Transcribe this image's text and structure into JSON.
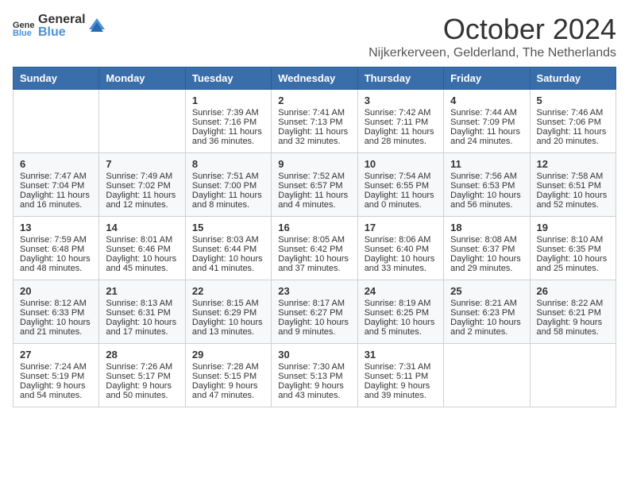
{
  "header": {
    "logo_general": "General",
    "logo_blue": "Blue",
    "month_title": "October 2024",
    "location": "Nijkerkerveen, Gelderland, The Netherlands"
  },
  "days_of_week": [
    "Sunday",
    "Monday",
    "Tuesday",
    "Wednesday",
    "Thursday",
    "Friday",
    "Saturday"
  ],
  "weeks": [
    [
      {
        "day": "",
        "content": ""
      },
      {
        "day": "",
        "content": ""
      },
      {
        "day": "1",
        "content": "Sunrise: 7:39 AM\nSunset: 7:16 PM\nDaylight: 11 hours\nand 36 minutes."
      },
      {
        "day": "2",
        "content": "Sunrise: 7:41 AM\nSunset: 7:13 PM\nDaylight: 11 hours\nand 32 minutes."
      },
      {
        "day": "3",
        "content": "Sunrise: 7:42 AM\nSunset: 7:11 PM\nDaylight: 11 hours\nand 28 minutes."
      },
      {
        "day": "4",
        "content": "Sunrise: 7:44 AM\nSunset: 7:09 PM\nDaylight: 11 hours\nand 24 minutes."
      },
      {
        "day": "5",
        "content": "Sunrise: 7:46 AM\nSunset: 7:06 PM\nDaylight: 11 hours\nand 20 minutes."
      }
    ],
    [
      {
        "day": "6",
        "content": "Sunrise: 7:47 AM\nSunset: 7:04 PM\nDaylight: 11 hours\nand 16 minutes."
      },
      {
        "day": "7",
        "content": "Sunrise: 7:49 AM\nSunset: 7:02 PM\nDaylight: 11 hours\nand 12 minutes."
      },
      {
        "day": "8",
        "content": "Sunrise: 7:51 AM\nSunset: 7:00 PM\nDaylight: 11 hours\nand 8 minutes."
      },
      {
        "day": "9",
        "content": "Sunrise: 7:52 AM\nSunset: 6:57 PM\nDaylight: 11 hours\nand 4 minutes."
      },
      {
        "day": "10",
        "content": "Sunrise: 7:54 AM\nSunset: 6:55 PM\nDaylight: 11 hours\nand 0 minutes."
      },
      {
        "day": "11",
        "content": "Sunrise: 7:56 AM\nSunset: 6:53 PM\nDaylight: 10 hours\nand 56 minutes."
      },
      {
        "day": "12",
        "content": "Sunrise: 7:58 AM\nSunset: 6:51 PM\nDaylight: 10 hours\nand 52 minutes."
      }
    ],
    [
      {
        "day": "13",
        "content": "Sunrise: 7:59 AM\nSunset: 6:48 PM\nDaylight: 10 hours\nand 48 minutes."
      },
      {
        "day": "14",
        "content": "Sunrise: 8:01 AM\nSunset: 6:46 PM\nDaylight: 10 hours\nand 45 minutes."
      },
      {
        "day": "15",
        "content": "Sunrise: 8:03 AM\nSunset: 6:44 PM\nDaylight: 10 hours\nand 41 minutes."
      },
      {
        "day": "16",
        "content": "Sunrise: 8:05 AM\nSunset: 6:42 PM\nDaylight: 10 hours\nand 37 minutes."
      },
      {
        "day": "17",
        "content": "Sunrise: 8:06 AM\nSunset: 6:40 PM\nDaylight: 10 hours\nand 33 minutes."
      },
      {
        "day": "18",
        "content": "Sunrise: 8:08 AM\nSunset: 6:37 PM\nDaylight: 10 hours\nand 29 minutes."
      },
      {
        "day": "19",
        "content": "Sunrise: 8:10 AM\nSunset: 6:35 PM\nDaylight: 10 hours\nand 25 minutes."
      }
    ],
    [
      {
        "day": "20",
        "content": "Sunrise: 8:12 AM\nSunset: 6:33 PM\nDaylight: 10 hours\nand 21 minutes."
      },
      {
        "day": "21",
        "content": "Sunrise: 8:13 AM\nSunset: 6:31 PM\nDaylight: 10 hours\nand 17 minutes."
      },
      {
        "day": "22",
        "content": "Sunrise: 8:15 AM\nSunset: 6:29 PM\nDaylight: 10 hours\nand 13 minutes."
      },
      {
        "day": "23",
        "content": "Sunrise: 8:17 AM\nSunset: 6:27 PM\nDaylight: 10 hours\nand 9 minutes."
      },
      {
        "day": "24",
        "content": "Sunrise: 8:19 AM\nSunset: 6:25 PM\nDaylight: 10 hours\nand 5 minutes."
      },
      {
        "day": "25",
        "content": "Sunrise: 8:21 AM\nSunset: 6:23 PM\nDaylight: 10 hours\nand 2 minutes."
      },
      {
        "day": "26",
        "content": "Sunrise: 8:22 AM\nSunset: 6:21 PM\nDaylight: 9 hours\nand 58 minutes."
      }
    ],
    [
      {
        "day": "27",
        "content": "Sunrise: 7:24 AM\nSunset: 5:19 PM\nDaylight: 9 hours\nand 54 minutes."
      },
      {
        "day": "28",
        "content": "Sunrise: 7:26 AM\nSunset: 5:17 PM\nDaylight: 9 hours\nand 50 minutes."
      },
      {
        "day": "29",
        "content": "Sunrise: 7:28 AM\nSunset: 5:15 PM\nDaylight: 9 hours\nand 47 minutes."
      },
      {
        "day": "30",
        "content": "Sunrise: 7:30 AM\nSunset: 5:13 PM\nDaylight: 9 hours\nand 43 minutes."
      },
      {
        "day": "31",
        "content": "Sunrise: 7:31 AM\nSunset: 5:11 PM\nDaylight: 9 hours\nand 39 minutes."
      },
      {
        "day": "",
        "content": ""
      },
      {
        "day": "",
        "content": ""
      }
    ]
  ]
}
